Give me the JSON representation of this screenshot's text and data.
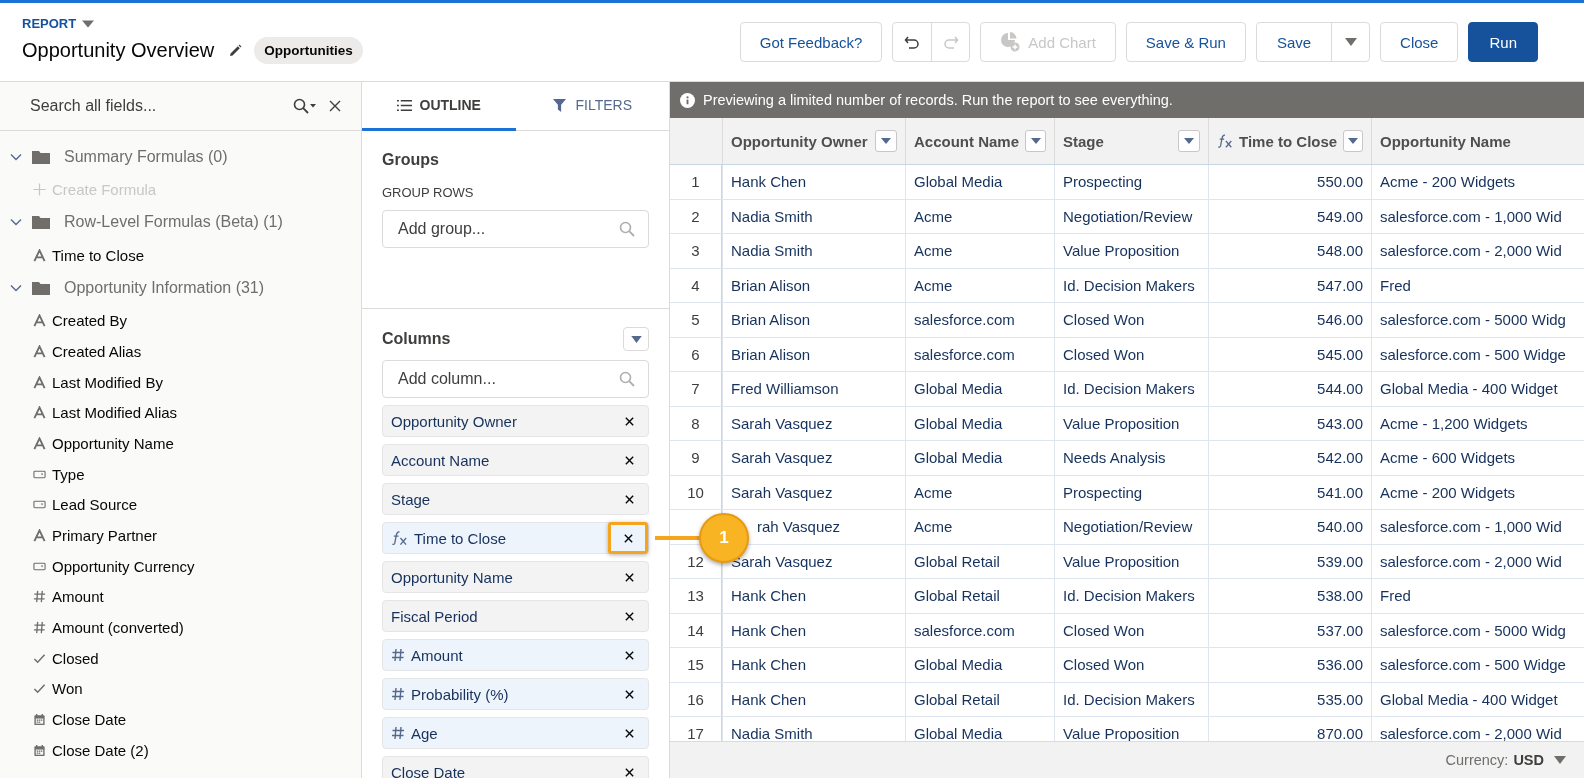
{
  "header": {
    "object_type": "REPORT",
    "title": "Opportunity Overview",
    "report_type": "Opportunities"
  },
  "toolbar": [
    {
      "kind": "button",
      "label": "Got Feedback?",
      "disabled": false
    },
    {
      "kind": "history",
      "items": [
        {
          "kind": "undo",
          "disabled": false
        },
        {
          "kind": "redo",
          "disabled": true
        }
      ]
    },
    {
      "kind": "chart-button",
      "label": "Add Chart",
      "disabled": true
    },
    {
      "kind": "button",
      "label": "Save & Run",
      "disabled": false
    },
    {
      "kind": "split",
      "label": "Save",
      "disabled": false
    },
    {
      "kind": "button",
      "label": "Close",
      "disabled": false
    },
    {
      "kind": "primary",
      "label": "Run",
      "disabled": false
    }
  ],
  "field_panel": {
    "search_placeholder": "Search all fields...",
    "folders": [
      {
        "name": "Summary Formulas (0)",
        "expanded": true,
        "children": [
          {
            "label": "Create Formula",
            "kind": "create",
            "disabled": true
          }
        ]
      },
      {
        "name": "Row-Level Formulas (Beta) (1)",
        "expanded": true,
        "children": [
          {
            "label": "Time to Close",
            "kind": "text",
            "disabled": false
          }
        ]
      },
      {
        "name": "Opportunity Information (31)",
        "expanded": true,
        "children": [
          {
            "label": "Created By",
            "kind": "text",
            "disabled": false
          },
          {
            "label": "Created Alias",
            "kind": "text",
            "disabled": false
          },
          {
            "label": "Last Modified By",
            "kind": "text",
            "disabled": false
          },
          {
            "label": "Last Modified Alias",
            "kind": "text",
            "disabled": false
          },
          {
            "label": "Opportunity Name",
            "kind": "text",
            "disabled": false
          },
          {
            "label": "Type",
            "kind": "picklist",
            "disabled": false
          },
          {
            "label": "Lead Source",
            "kind": "picklist",
            "disabled": false
          },
          {
            "label": "Primary Partner",
            "kind": "text",
            "disabled": false
          },
          {
            "label": "Opportunity Currency",
            "kind": "picklist",
            "disabled": false
          },
          {
            "label": "Amount",
            "kind": "number",
            "disabled": false
          },
          {
            "label": "Amount (converted)",
            "kind": "number",
            "disabled": false
          },
          {
            "label": "Closed",
            "kind": "checkbox",
            "disabled": false
          },
          {
            "label": "Won",
            "kind": "checkbox",
            "disabled": false
          },
          {
            "label": "Close Date",
            "kind": "date",
            "disabled": false
          },
          {
            "label": "Close Date (2)",
            "kind": "date",
            "disabled": false
          }
        ]
      }
    ]
  },
  "outline": {
    "tabs": [
      {
        "label": "OUTLINE",
        "kind": "outline",
        "selected": true
      },
      {
        "label": "FILTERS",
        "kind": "filters",
        "selected": false
      }
    ],
    "groups_title": "Groups",
    "group_rows_label": "GROUP ROWS",
    "group_placeholder": "Add group...",
    "columns_title": "Columns",
    "column_placeholder": "Add column...",
    "columns": [
      {
        "label": "Opportunity Owner",
        "kind": "text",
        "highlighted": false
      },
      {
        "label": "Account Name",
        "kind": "text",
        "highlighted": false
      },
      {
        "label": "Stage",
        "kind": "text",
        "highlighted": false
      },
      {
        "label": "Time to Close",
        "kind": "formula",
        "highlighted": true
      },
      {
        "label": "Opportunity Name",
        "kind": "text",
        "highlighted": false
      },
      {
        "label": "Fiscal Period",
        "kind": "text",
        "highlighted": false
      },
      {
        "label": "Amount",
        "kind": "number",
        "highlighted": false
      },
      {
        "label": "Probability (%)",
        "kind": "number",
        "highlighted": false
      },
      {
        "label": "Age",
        "kind": "number",
        "highlighted": false
      },
      {
        "label": "Close Date",
        "kind": "text",
        "highlighted": false
      }
    ]
  },
  "callout": {
    "label": "1"
  },
  "preview_notice": "Previewing a limited number of records. Run the report to see everything.",
  "table": {
    "columns": [
      {
        "label": "Opportunity Owner",
        "kind": "text",
        "menu": true
      },
      {
        "label": "Account Name",
        "kind": "text",
        "menu": true
      },
      {
        "label": "Stage",
        "kind": "text",
        "menu": true
      },
      {
        "label": "Time to Close",
        "kind": "formula",
        "menu": true
      },
      {
        "label": "Opportunity Name",
        "kind": "text",
        "menu": false
      }
    ],
    "rows": [
      {
        "num": "1",
        "cells": [
          "Hank Chen",
          "Global Media",
          "Prospecting",
          "550.00",
          "Acme - 200 Widgets"
        ]
      },
      {
        "num": "2",
        "cells": [
          "Nadia Smith",
          "Acme",
          "Negotiation/Review",
          "549.00",
          "salesforce.com - 1,000 Wid"
        ]
      },
      {
        "num": "3",
        "cells": [
          "Nadia Smith",
          "Acme",
          "Value Proposition",
          "548.00",
          "salesforce.com - 2,000 Wid"
        ]
      },
      {
        "num": "4",
        "cells": [
          "Brian Alison",
          "Acme",
          "Id. Decision Makers",
          "547.00",
          "Fred"
        ]
      },
      {
        "num": "5",
        "cells": [
          "Brian Alison",
          "salesforce.com",
          "Closed Won",
          "546.00",
          "salesforce.com - 5000 Widg"
        ]
      },
      {
        "num": "6",
        "cells": [
          "Brian Alison",
          "salesforce.com",
          "Closed Won",
          "545.00",
          "salesforce.com - 500 Widge"
        ]
      },
      {
        "num": "7",
        "cells": [
          "Fred Williamson",
          "Global Media",
          "Id. Decision Makers",
          "544.00",
          "Global Media - 400 Widget"
        ]
      },
      {
        "num": "8",
        "cells": [
          "Sarah Vasquez",
          "Global Media",
          "Value Proposition",
          "543.00",
          "Acme - 1,200 Widgets"
        ]
      },
      {
        "num": "9",
        "cells": [
          "Sarah Vasquez",
          "Global Media",
          "Needs Analysis",
          "542.00",
          "Acme - 600 Widgets"
        ]
      },
      {
        "num": "10",
        "cells": [
          "Sarah Vasquez",
          "Acme",
          "Prospecting",
          "541.00",
          "Acme - 200 Widgets"
        ]
      },
      {
        "partly_covered": true,
        "cells": [
          "rah Vasquez",
          "Acme",
          "Negotiation/Review",
          "540.00",
          "salesforce.com - 1,000 Wid"
        ]
      },
      {
        "num": "12",
        "cells": [
          "Sarah Vasquez",
          "Global Retail",
          "Value Proposition",
          "539.00",
          "salesforce.com - 2,000 Wid"
        ]
      },
      {
        "num": "13",
        "cells": [
          "Hank Chen",
          "Global Retail",
          "Id. Decision Makers",
          "538.00",
          "Fred"
        ]
      },
      {
        "num": "14",
        "cells": [
          "Hank Chen",
          "salesforce.com",
          "Closed Won",
          "537.00",
          "salesforce.com - 5000 Widg"
        ]
      },
      {
        "num": "15",
        "cells": [
          "Hank Chen",
          "Global Media",
          "Closed Won",
          "536.00",
          "salesforce.com - 500 Widge"
        ]
      },
      {
        "num": "16",
        "cells": [
          "Hank Chen",
          "Global Retail",
          "Id. Decision Makers",
          "535.00",
          "Global Media - 400 Widget"
        ]
      },
      {
        "num": "17",
        "cells": [
          "Nadia Smith",
          "Global Media",
          "Value Proposition",
          "870.00",
          "salesforce.com - 2,000 Wid"
        ]
      }
    ]
  },
  "footer": {
    "label": "Currency:",
    "value": "USD"
  }
}
